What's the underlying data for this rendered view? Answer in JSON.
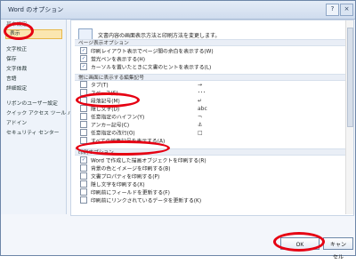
{
  "window": {
    "title": "Word のオプション"
  },
  "sidebar": {
    "items": [
      {
        "label": "基本設定",
        "selected": false
      },
      {
        "label": "表示",
        "selected": true
      },
      {
        "label": "文字校正",
        "selected": false
      },
      {
        "label": "保存",
        "selected": false
      },
      {
        "label": "文字体裁",
        "selected": false
      },
      {
        "label": "言語",
        "selected": false
      },
      {
        "label": "詳細設定",
        "selected": false
      },
      {
        "label": "リボンのユーザー設定",
        "selected": false
      },
      {
        "label": "クイック アクセス ツール バー",
        "selected": false
      },
      {
        "label": "アドイン",
        "selected": false
      },
      {
        "label": "セキュリティ センター",
        "selected": false
      }
    ]
  },
  "main": {
    "description": "文書内容の画面表示方法と印刷方法を変更します。",
    "sections": [
      {
        "title": "ページ表示オプション",
        "items": [
          {
            "label": "印刷レイアウト表示でページ間の余白を表示する(W)",
            "checked": true
          },
          {
            "label": "蛍光ペンを表示する(H)",
            "checked": true
          },
          {
            "label": "カーソルを置いたときに文書のヒントを表示する(L)",
            "checked": true
          }
        ]
      },
      {
        "title": "常に画面に表示する編集記号",
        "items": [
          {
            "label": "タブ(T)",
            "symbol": "→",
            "checked": false
          },
          {
            "label": "スペース(S)",
            "symbol": "･･･",
            "checked": false
          },
          {
            "label": "段落記号(M)",
            "symbol": "↵",
            "checked": false
          },
          {
            "label": "隠し文字(D)",
            "symbol": "abc",
            "checked": false
          },
          {
            "label": "任意指定のハイフン(Y)",
            "symbol": "¬",
            "checked": false
          },
          {
            "label": "アンカー記号(C)",
            "symbol": "⚓",
            "checked": false
          },
          {
            "label": "任意指定の改行(O)",
            "symbol": "□",
            "checked": false
          },
          {
            "label": "すべての編集記号を表示する(A)",
            "symbol": "",
            "checked": false
          }
        ]
      },
      {
        "title": "印刷オプション",
        "items": [
          {
            "label": "Word で作成した描画オブジェクトを印刷する(R)",
            "checked": true
          },
          {
            "label": "背景の色とイメージを印刷する(B)",
            "checked": false
          },
          {
            "label": "文書プロパティを印刷する(P)",
            "checked": false
          },
          {
            "label": "隠し文字を印刷する(X)",
            "checked": false
          },
          {
            "label": "印刷前にフィールドを更新する(F)",
            "checked": false
          },
          {
            "label": "印刷前にリンクされているデータを更新する(K)",
            "checked": false
          }
        ]
      }
    ]
  },
  "footer": {
    "ok_label": "OK",
    "cancel_label": "キャンセル"
  },
  "colors": {
    "selection": "#fbe6b0",
    "annotation": "#e60012"
  }
}
